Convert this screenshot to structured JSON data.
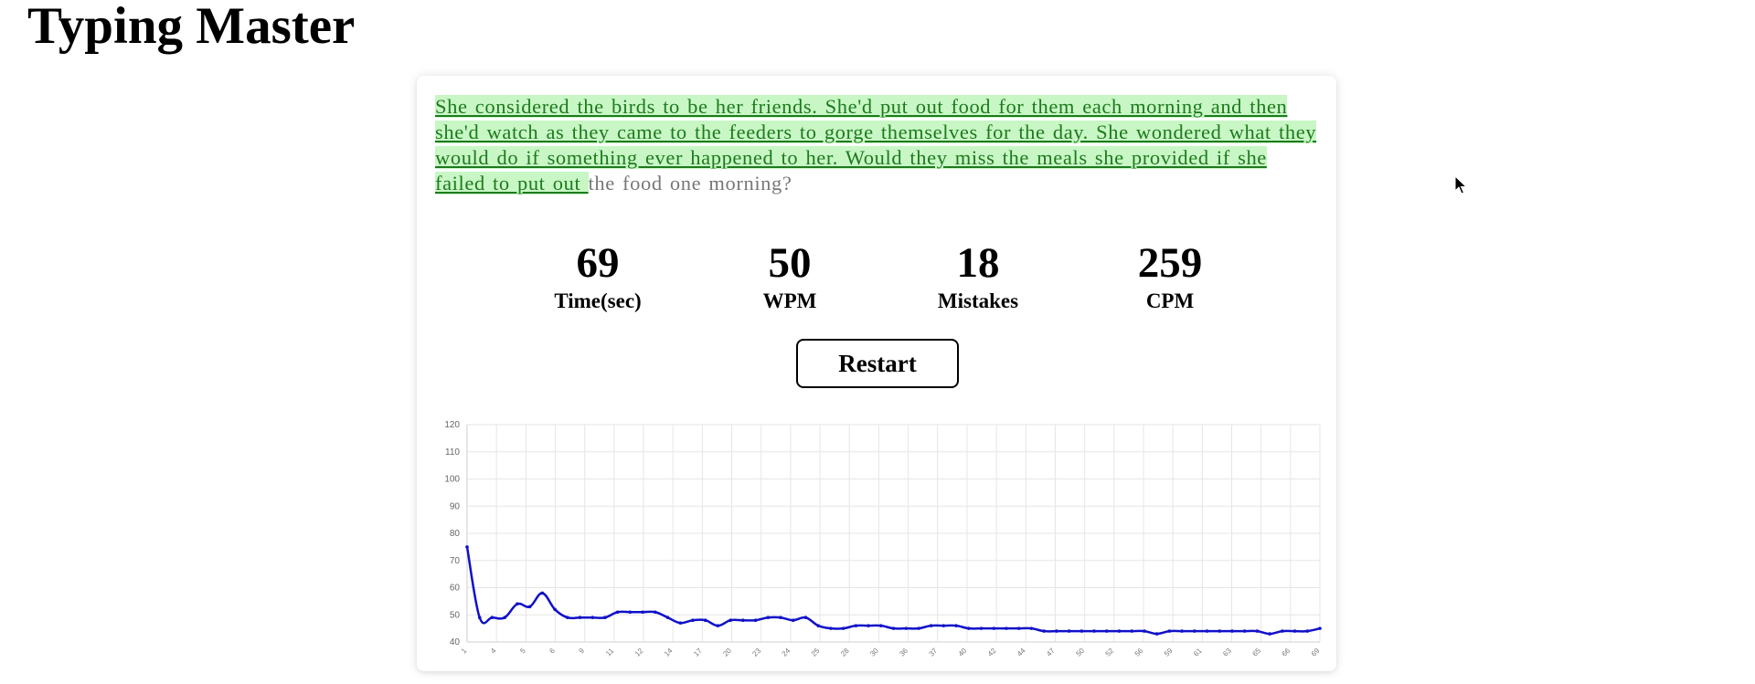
{
  "app": {
    "title": "Typing Master"
  },
  "passage": {
    "typed": "She considered the birds to be her friends. She'd put out food for them each morning and then she'd watch as they came to the feeders to gorge themselves for the day. She wondered what they would do if something ever happened to her. Would they miss the meals she provided if she failed to put out ",
    "remaining": "the food one morning?"
  },
  "stats": [
    {
      "value": "69",
      "label": "Time(sec)"
    },
    {
      "value": "50",
      "label": "WPM"
    },
    {
      "value": "18",
      "label": "Mistakes"
    },
    {
      "value": "259",
      "label": "CPM"
    }
  ],
  "restart": {
    "label": "Restart"
  },
  "colors": {
    "typed_bg": "#c8f7c5",
    "typed_text": "#1d7a1d",
    "line": "#1010c8",
    "grid": "#e6e6e6"
  },
  "chart_data": {
    "type": "line",
    "title": "",
    "xlabel": "",
    "ylabel": "",
    "ylim": [
      40,
      120
    ],
    "yticks": [
      40,
      50,
      60,
      70,
      80,
      90,
      100,
      110,
      120
    ],
    "grid": true,
    "x": [
      1,
      2,
      3,
      4,
      5,
      6,
      7,
      8,
      9,
      10,
      11,
      12,
      13,
      14,
      15,
      16,
      17,
      18,
      19,
      20,
      21,
      22,
      23,
      24,
      25,
      26,
      27,
      28,
      29,
      30,
      31,
      32,
      33,
      34,
      35,
      36,
      37,
      38,
      39,
      40,
      41,
      42,
      43,
      44,
      45,
      46,
      47,
      48,
      49,
      50,
      51,
      52,
      53,
      54,
      55,
      56,
      57,
      58,
      59,
      60,
      61,
      62,
      63,
      64,
      65,
      66,
      67,
      68,
      69
    ],
    "x_tick_labels": [
      "1",
      "4",
      "5",
      "6",
      "9",
      "11",
      "12",
      "14",
      "17",
      "20",
      "23",
      "24",
      "25",
      "28",
      "30",
      "36",
      "37",
      "40",
      "42",
      "44",
      "47",
      "50",
      "52",
      "56",
      "59",
      "61",
      "63",
      "65",
      "66",
      "69"
    ],
    "series": [
      {
        "values": [
          75,
          49,
          49,
          49,
          54,
          53,
          58,
          52,
          49,
          49,
          49,
          49,
          51,
          51,
          51,
          51,
          49,
          47,
          48,
          48,
          46,
          48,
          48,
          48,
          49,
          49,
          48,
          49,
          46,
          45,
          45,
          46,
          46,
          46,
          45,
          45,
          45,
          46,
          46,
          46,
          45,
          45,
          45,
          45,
          45,
          45,
          44,
          44,
          44,
          44,
          44,
          44,
          44,
          44,
          44,
          43,
          44,
          44,
          44,
          44,
          44,
          44,
          44,
          44,
          43,
          44,
          44,
          44,
          45
        ]
      }
    ]
  }
}
